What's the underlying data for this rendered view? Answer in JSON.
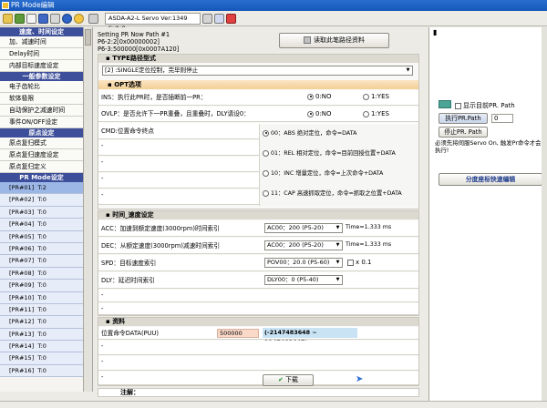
{
  "window": {
    "title": "PR Mode编辑"
  },
  "toolbar": {
    "status": "ASDA-A2-L Servo Ver:1349 Sub:0"
  },
  "nav": {
    "cat1": "速度、时间设定",
    "cat1_items": [
      "加、减速时间",
      "Delay时间",
      "内部目标速度设定"
    ],
    "cat2": "一般参数设定",
    "cat2_items": [
      "电子齿轮比",
      "软体极限",
      "自动保护之减速时间",
      "事件ON/OFF设定"
    ],
    "cat3": "原点设定",
    "cat3_items": [
      "原点复归模式",
      "原点复归速度设定",
      "原点复归定义"
    ],
    "cat4": "PR Mode设定",
    "pr_rows": [
      "[PR#01]  T:2",
      "[PR#02]  T:0",
      "[PR#03]  T:0",
      "[PR#04]  T:0",
      "[PR#05]  T:0",
      "[PR#06]  T:0",
      "[PR#07]  T:0",
      "[PR#08]  T:0",
      "[PR#09]  T:0",
      "[PR#10]  T:0",
      "[PR#11]  T:0",
      "[PR#12]  T:0",
      "[PR#13]  T:0",
      "[PR#14]  T:0",
      "[PR#15]  T:0",
      "[PR#16]  T:0"
    ]
  },
  "main": {
    "setting_line": "Setting PR Now Path #1",
    "p6_line": "P6-2:2[0x00000002]",
    "p6_line2": "P6-3:500000[0x0007A120]",
    "read_button": "读取此笔路径资料",
    "type_header": "TYPE路径型式",
    "type_value": "[2] :SINGLE定位控制，完毕则停止",
    "opt_header": "OPT选项",
    "ins_label": "INS：执行此PR时，是否插断前一PR：",
    "ins_opt_no": "0:NO",
    "ins_opt_yes": "1:YES",
    "ins_selected": "0:NO",
    "ovlp_label": "OVLP：是否允许下一PR重叠，且重叠时，DLY请设0：",
    "ovlp_opt_no": "0:NO",
    "ovlp_opt_yes": "1:YES",
    "ovlp_selected": "0:NO",
    "cmd_label": "CMD:位置命令终点",
    "cmd_opts": [
      "00：ABS 绝对定位，命令=DATA",
      "01：REL 相对定位，命令=目前回授位置+DATA",
      "10：INC 增量定位，命令=上次命令+DATA",
      "11：CAP 高速抓取定位，命令=抓取之位置+DATA"
    ],
    "cmd_selected": "00：ABS 绝对定位，命令=DATA",
    "time_header": "时间_速度设定",
    "acc_label": "ACC：加速到额定速度(3000rpm)时间索引",
    "acc_value": "AC00：200 (P5-20)",
    "acc_time": "Time=1.333 ms",
    "dec_label": "DEC：从额定速度(3000rpm)减速时间索引",
    "dec_value": "AC00：200 (P5-20)",
    "dec_time": "Time=1.333 ms",
    "spd_label": "SPD：目标速度索引",
    "spd_value": "POV00：20.0 (P5-60)",
    "spd_x": "x 0.1",
    "dly_label": "DLY：延迟时间索引",
    "dly_value": "DLY00：0 (P5-40)",
    "data_header": "资料",
    "pos_label": "位置命令DATA(PUU)",
    "pos_value": "500000",
    "pos_range": "(-2147483648 ~ 2147483647)",
    "note_label": "注解：",
    "download_button": "下载"
  },
  "right": {
    "show_path_label": "显示目前PR. Path",
    "exec_button": "执行PR.Path",
    "exec_value": "0",
    "stop_button": "停止PR. Path",
    "warning": "必须先将伺服Servo On, 触发Pr命令才会执行!",
    "quick_edit": "分度座标快速编辑"
  },
  "colors": {
    "nav_category": "#3d4f9a",
    "opt_header": "#f3cf95",
    "pr_selected": "#9cb6e6",
    "pos_value_bg": "#fbd9c8",
    "range_bg": "#c9e3f5"
  }
}
